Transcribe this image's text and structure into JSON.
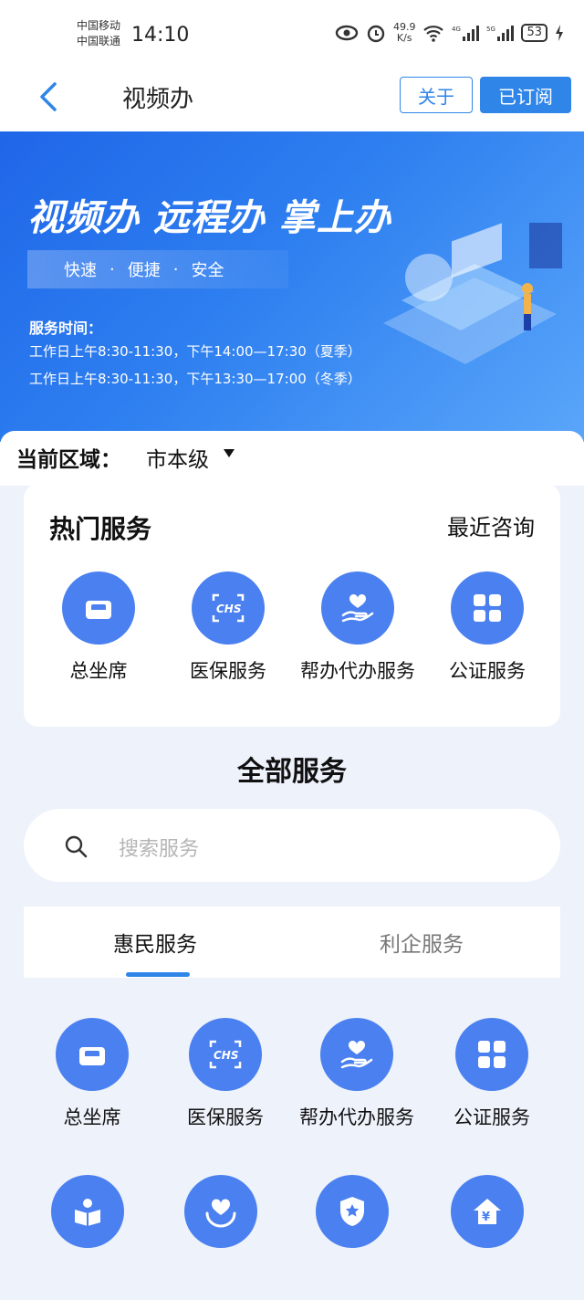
{
  "status_bar": {
    "carrier1": "中国移动",
    "carrier2": "中国联通",
    "time": "14:10",
    "net_speed": "49.9",
    "net_unit": "K/s",
    "battery": "53"
  },
  "header": {
    "title": "视频办",
    "about_label": "关于",
    "subscribed_label": "已订阅"
  },
  "banner": {
    "headline": "视频办 远程办 掌上办",
    "tags": [
      "快速",
      "便捷",
      "安全"
    ],
    "hours_label": "服务时间：",
    "hours": [
      "工作日上午8:30-11:30，下午14:00—17:30（夏季）",
      "工作日上午8:30-11:30，下午13:30—17:00（冬季）"
    ]
  },
  "region": {
    "label": "当前区域：",
    "value": "市本级"
  },
  "hot_services": {
    "title": "热门服务",
    "recent": "最近咨询",
    "items": [
      {
        "label": "总坐席",
        "icon": "sofa-icon"
      },
      {
        "label": "医保服务",
        "icon": "chs-icon"
      },
      {
        "label": "帮办代办服务",
        "icon": "heart-hand-icon"
      },
      {
        "label": "公证服务",
        "icon": "grid-icon"
      }
    ]
  },
  "all_services": {
    "title": "全部服务",
    "search_placeholder": "搜索服务",
    "tabs": [
      "惠民服务",
      "利企服务"
    ],
    "items": [
      {
        "label": "总坐席",
        "icon": "sofa-icon"
      },
      {
        "label": "医保服务",
        "icon": "chs-icon"
      },
      {
        "label": "帮办代办服务",
        "icon": "heart-hand-icon"
      },
      {
        "label": "公证服务",
        "icon": "grid-icon"
      },
      {
        "label": "",
        "icon": "book-reader-icon"
      },
      {
        "label": "",
        "icon": "heart-care-icon"
      },
      {
        "label": "",
        "icon": "shield-star-icon"
      },
      {
        "label": "",
        "icon": "house-yen-icon"
      }
    ]
  },
  "colors": {
    "accent": "#2f86e8",
    "icon_bg": "#4a80ef",
    "page_bg": "#eef2fb"
  }
}
